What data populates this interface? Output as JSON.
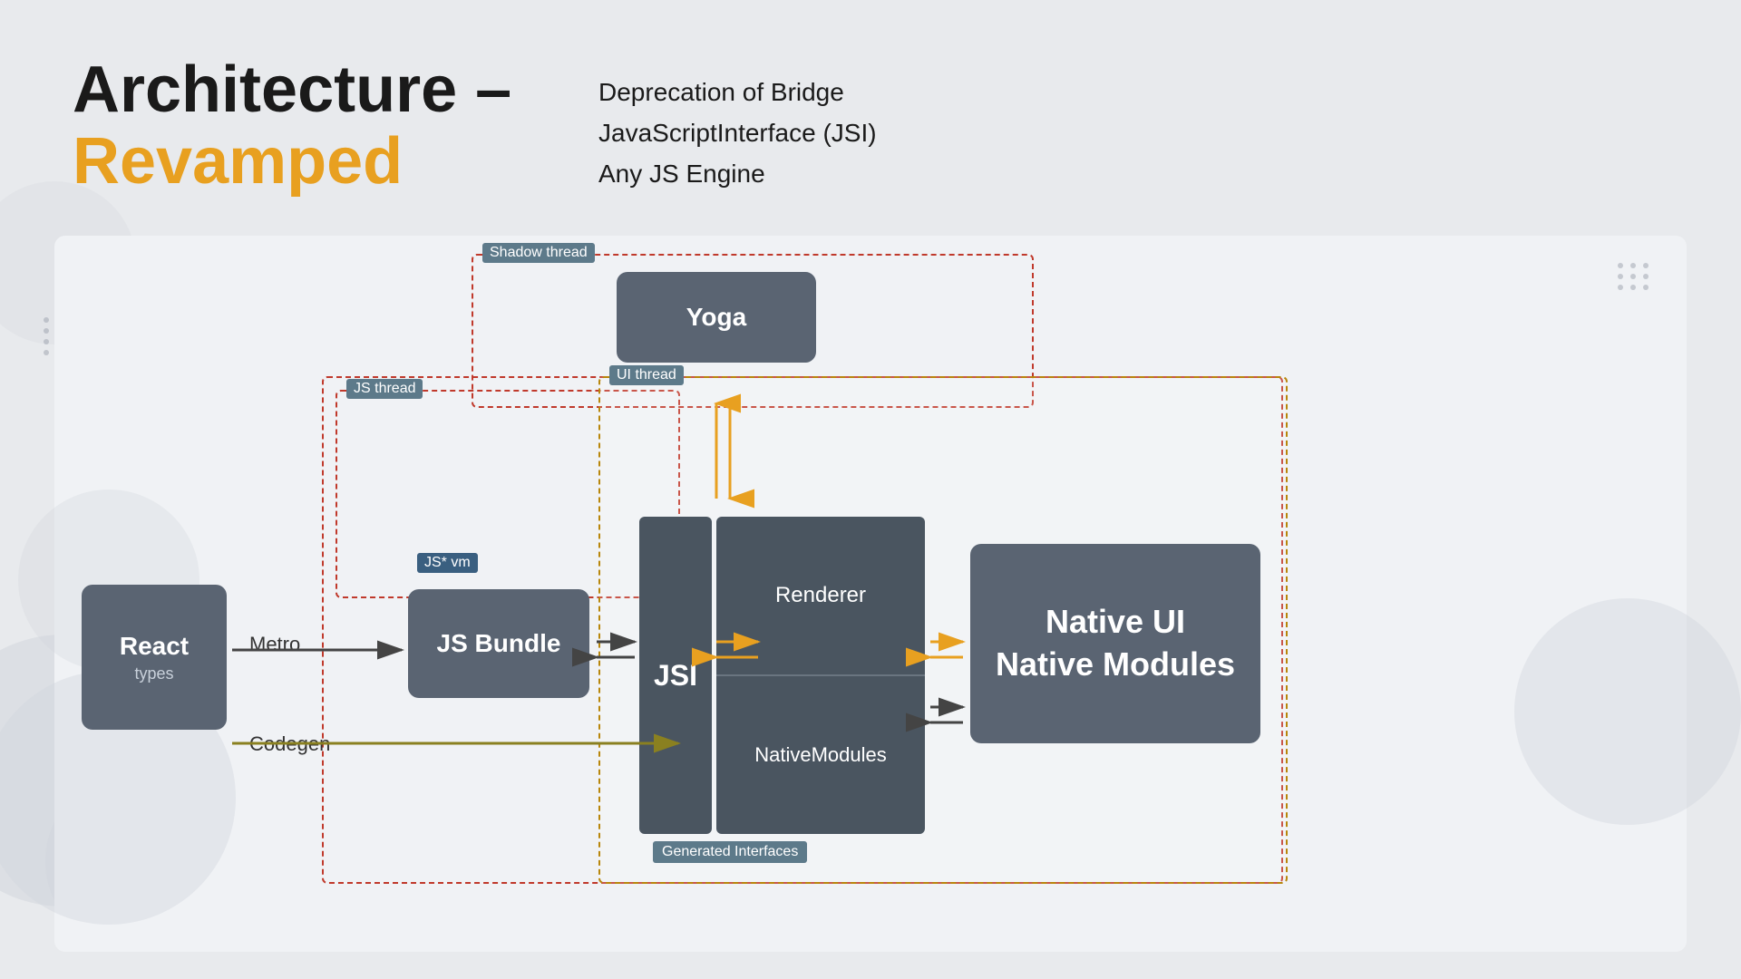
{
  "header": {
    "title_line1": "Architecture –",
    "title_line2": "Revamped"
  },
  "bullets": {
    "item1": "Deprecation of Bridge",
    "item2": "JavaScriptInterface (JSI)",
    "item3": "Any JS Engine"
  },
  "diagram": {
    "labels": {
      "shadow_thread": "Shadow thread",
      "js_thread": "JS thread",
      "ui_thread": "UI thread",
      "jsvm": "JS* vm",
      "generated_interfaces": "Generated Interfaces",
      "react": "React",
      "types": "types",
      "metro": "Metro",
      "codegen": "Codegen",
      "js_bundle": "JS Bundle",
      "jsi": "JSI",
      "yoga": "Yoga",
      "renderer": "Renderer",
      "native_modules_inner": "NativeModules",
      "native_ui": "Native UI",
      "native_modules": "Native Modules"
    }
  },
  "dots": {
    "count": 6
  }
}
